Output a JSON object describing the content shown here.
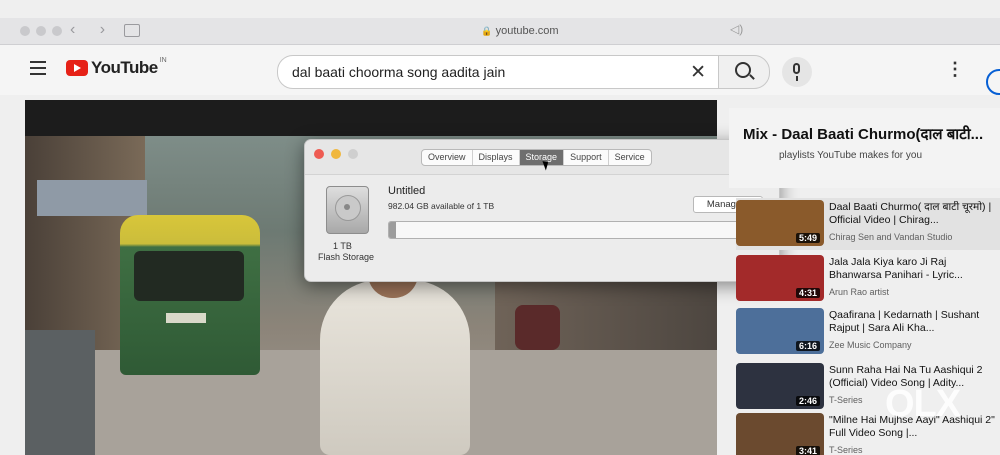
{
  "browser": {
    "address": "youtube.com"
  },
  "youtube": {
    "logo_text": "YouTube",
    "country": "IN",
    "search_query": "dal baati choorma song aadita jain",
    "more_glyph": "⋮"
  },
  "about_window": {
    "tabs": [
      "Overview",
      "Displays",
      "Storage",
      "Support",
      "Service"
    ],
    "active_tab": "Storage",
    "volume_name": "Untitled",
    "available": "982.04 GB available of 1 TB",
    "used_fraction": 0.018,
    "disk_size": "1 TB",
    "disk_kind": "Flash Storage",
    "manage_label": "Manage..."
  },
  "mix": {
    "title": "Mix - Daal Baati Churmo(दाल बाटी...",
    "subtitle": "playlists YouTube makes for you"
  },
  "recommendations": [
    {
      "title": "Daal Baati Churmo( दाल बाटी चूरमो) | Official Video | Chirag...",
      "channel": "Chirag Sen and Vandan Studio",
      "duration": "5:49",
      "thumb_color": "#8a5a2b"
    },
    {
      "title": "Jala Jala Kiya karo Ji Raj Bhanwarsa Panihari - Lyric...",
      "channel": "Arun Rao artist",
      "duration": "4:31",
      "thumb_color": "#a32a2a"
    },
    {
      "title": "Qaafirana | Kedarnath | Sushant Rajput | Sara Ali Kha...",
      "channel": "Zee Music Company",
      "duration": "6:16",
      "thumb_color": "#4d6f9a"
    },
    {
      "title": "Sunn Raha Hai Na Tu Aashiqui 2 (Official) Video Song | Adity...",
      "channel": "T-Series",
      "duration": "2:46",
      "thumb_color": "#2d3240"
    },
    {
      "title": "\"Milne Hai Mujhse Aayi\" Aashiqui 2\" Full Video Song |...",
      "channel": "T-Series",
      "duration": "3:41",
      "thumb_color": "#6b4a2f"
    }
  ],
  "watermark": "OLX",
  "colors": {
    "yt_red": "#e62117",
    "active_tab": "#6e6e6e",
    "account_blue": "#065fd4"
  }
}
